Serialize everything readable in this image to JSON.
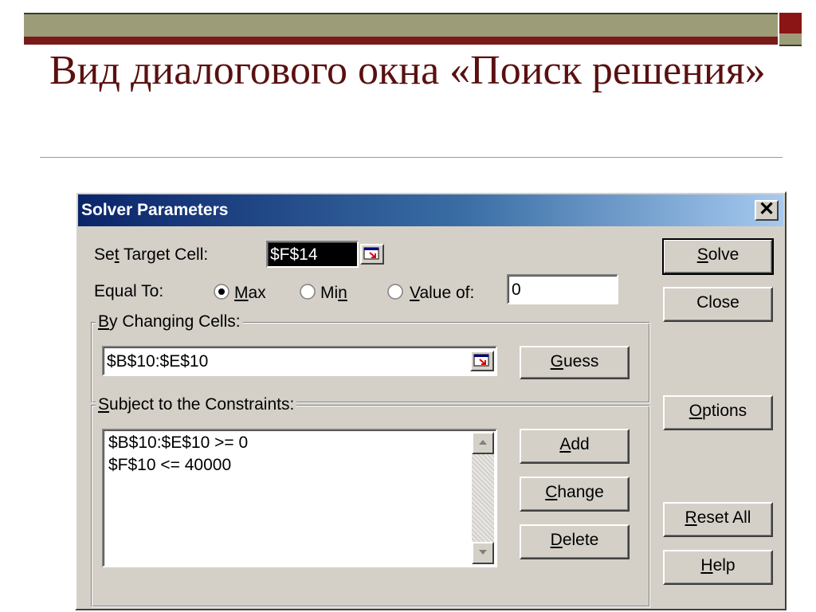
{
  "slide": {
    "title": "Вид диалогового окна «Поиск решения»"
  },
  "dialog": {
    "title": "Solver Parameters",
    "close_label": "✕",
    "target_cell": {
      "label_pre": "Se",
      "label_accel": "t",
      "label_post": " Target Cell:",
      "value": "$F$14"
    },
    "equal_to": {
      "label": "Equal To:",
      "options": [
        {
          "pre": "",
          "accel": "M",
          "post": "ax",
          "selected": true
        },
        {
          "pre": "Mi",
          "accel": "n",
          "post": "",
          "selected": false
        },
        {
          "pre": "",
          "accel": "V",
          "post": "alue of:",
          "selected": false
        }
      ],
      "value_of": "0"
    },
    "changing_cells": {
      "label_pre": "",
      "label_accel": "B",
      "label_post": "y Changing Cells:",
      "value": "$B$10:$E$10"
    },
    "constraints": {
      "label_pre": "",
      "label_accel": "S",
      "label_post": "ubject to the Constraints:",
      "items": [
        "$B$10:$E$10 >= 0",
        "$F$10 <= 40000"
      ]
    },
    "buttons": {
      "solve": {
        "pre": "",
        "accel": "S",
        "post": "olve"
      },
      "close": {
        "label": "Close"
      },
      "guess": {
        "pre": "",
        "accel": "G",
        "post": "uess"
      },
      "options": {
        "pre": "",
        "accel": "O",
        "post": "ptions"
      },
      "add": {
        "pre": "",
        "accel": "A",
        "post": "dd"
      },
      "change": {
        "pre": "",
        "accel": "C",
        "post": "hange"
      },
      "delete": {
        "pre": "",
        "accel": "D",
        "post": "elete"
      },
      "reset_all": {
        "pre": "",
        "accel": "R",
        "post": "eset All"
      },
      "help": {
        "pre": "",
        "accel": "H",
        "post": "elp"
      }
    }
  }
}
